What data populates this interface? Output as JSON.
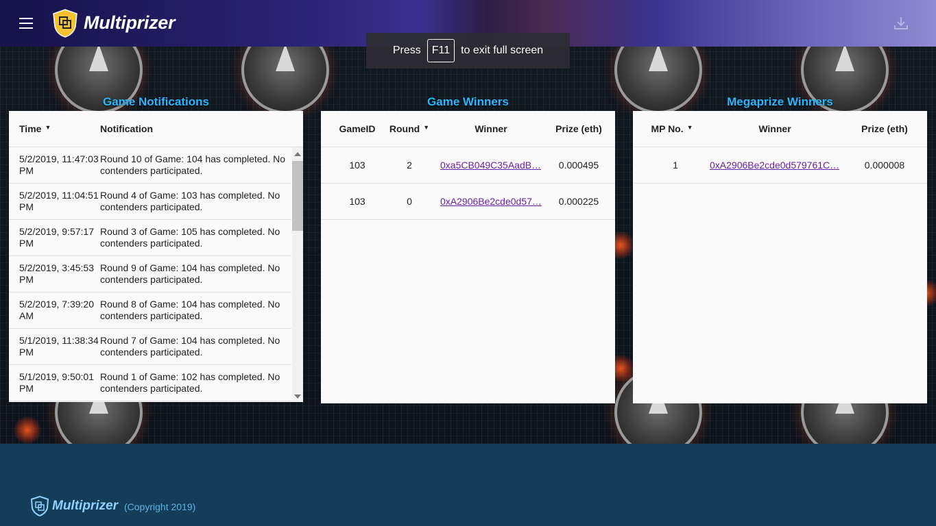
{
  "app": {
    "brand": "Multiprizer",
    "fullscreen_hint": {
      "before": "Press",
      "key": "F11",
      "after": "to exit full screen"
    }
  },
  "notifications": {
    "title": "Game Notifications",
    "columns": [
      "Time",
      "Notification"
    ],
    "rows": [
      {
        "time": "5/2/2019, 11:47:03 PM",
        "message": "Round 10 of Game: 104 has completed. No contenders participated."
      },
      {
        "time": "5/2/2019, 11:04:51 PM",
        "message": "Round 4 of Game: 103 has completed. No contenders participated."
      },
      {
        "time": "5/2/2019, 9:57:17 PM",
        "message": "Round 3 of Game: 105 has completed. No contenders participated."
      },
      {
        "time": "5/2/2019, 3:45:53 PM",
        "message": "Round 9 of Game: 104 has completed. No contenders participated."
      },
      {
        "time": "5/2/2019, 7:39:20 AM",
        "message": "Round 8 of Game: 104 has completed. No contenders participated."
      },
      {
        "time": "5/1/2019, 11:38:34 PM",
        "message": "Round 7 of Game: 104 has completed. No contenders participated."
      },
      {
        "time": "5/1/2019, 9:50:01 PM",
        "message": "Round 1 of Game: 102 has completed. No contenders participated."
      }
    ]
  },
  "game_winners": {
    "title": "Game Winners",
    "columns": [
      "GameID",
      "Round",
      "Winner",
      "Prize (eth)"
    ],
    "rows": [
      {
        "game_id": "103",
        "round": "2",
        "winner": "0xa5CB049C35AadB…",
        "prize": "0.000495"
      },
      {
        "game_id": "103",
        "round": "0",
        "winner": "0xA2906Be2cde0d57…",
        "prize": "0.000225"
      }
    ]
  },
  "megaprize_winners": {
    "title": "Megaprize Winners",
    "columns": [
      "MP No.",
      "Winner",
      "Prize (eth)"
    ],
    "rows": [
      {
        "mp_no": "1",
        "winner": "0xA2906Be2cde0d579761C…",
        "prize": "0.000008"
      }
    ]
  },
  "footer": {
    "brand": "Multiprizer",
    "copyright": "(Copyright 2019)"
  },
  "colors": {
    "accent": "#29b8ff",
    "link": "#6b1fa8",
    "footer_bg": "#133d58"
  }
}
